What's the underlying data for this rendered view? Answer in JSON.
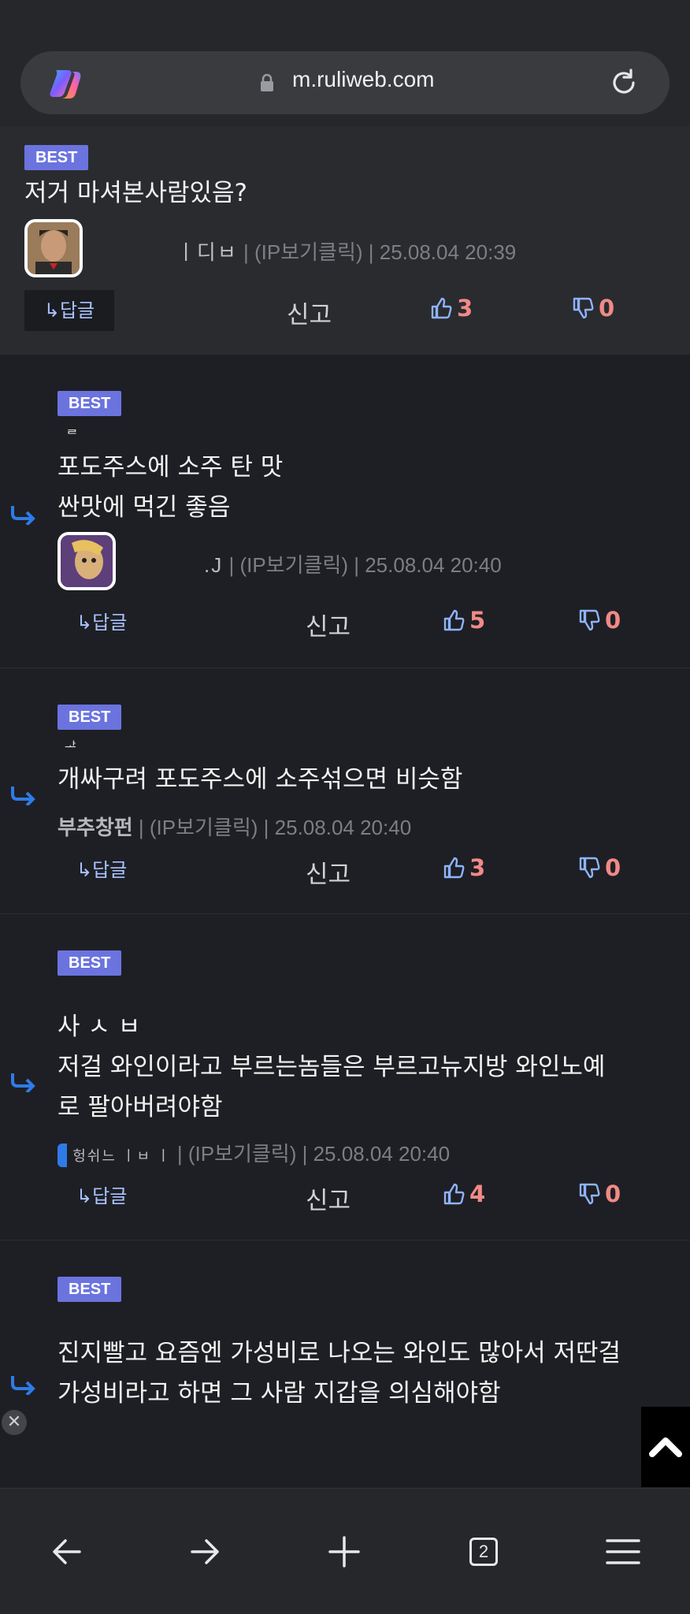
{
  "browser": {
    "url": "m.ruliweb.com"
  },
  "comments": [
    {
      "badge": "BEST",
      "text": "저거 마셔본사람있음?",
      "author": "ㅣ디ㅂ",
      "meta": "| (IP보기클릭) | 25.08.04 20:39",
      "reply": "↳답글",
      "report": "신고",
      "likes": "3",
      "dislikes": "0"
    },
    {
      "badge": "BEST",
      "text": "포도주스에 소주 탄 맛\n싼맛에 먹긴 좋음",
      "author": ".J",
      "meta": "| (IP보기클릭) | 25.08.04 20:40",
      "reply": "↳답글",
      "report": "신고",
      "likes": "5",
      "dislikes": "0"
    },
    {
      "badge": "BEST",
      "text": "개싸구려 포도주스에 소주섞으면 비슷함",
      "author": "부추창펀",
      "meta": "| (IP보기클릭) | 25.08.04 20:40",
      "reply": "↳답글",
      "report": "신고",
      "likes": "3",
      "dislikes": "0"
    },
    {
      "badge": "BEST",
      "text": "사 ㅅ ㅂ\n저걸 와인이라고 부르는놈들은 부르고뉴지방 와인노예\n로 팔아버려야함",
      "author": "헝쉬느 ㅣㅂ ㅣ",
      "meta": "| (IP보기클릭) | 25.08.04 20:40",
      "reply": "↳답글",
      "report": "신고",
      "likes": "4",
      "dislikes": "0"
    },
    {
      "badge": "BEST",
      "text": "진지빨고 요즘엔 가성비로 나오는 와인도 많아서 저딴걸\n가성비라고 하면 그 사람 지갑을 의심해야함"
    }
  ],
  "nav": {
    "tab_count": "2"
  },
  "colors": {
    "badge": "#6b73de",
    "likes": "#f08a86",
    "thumb": "#8fb3ff",
    "reply_arrow": "#2e7be8"
  }
}
